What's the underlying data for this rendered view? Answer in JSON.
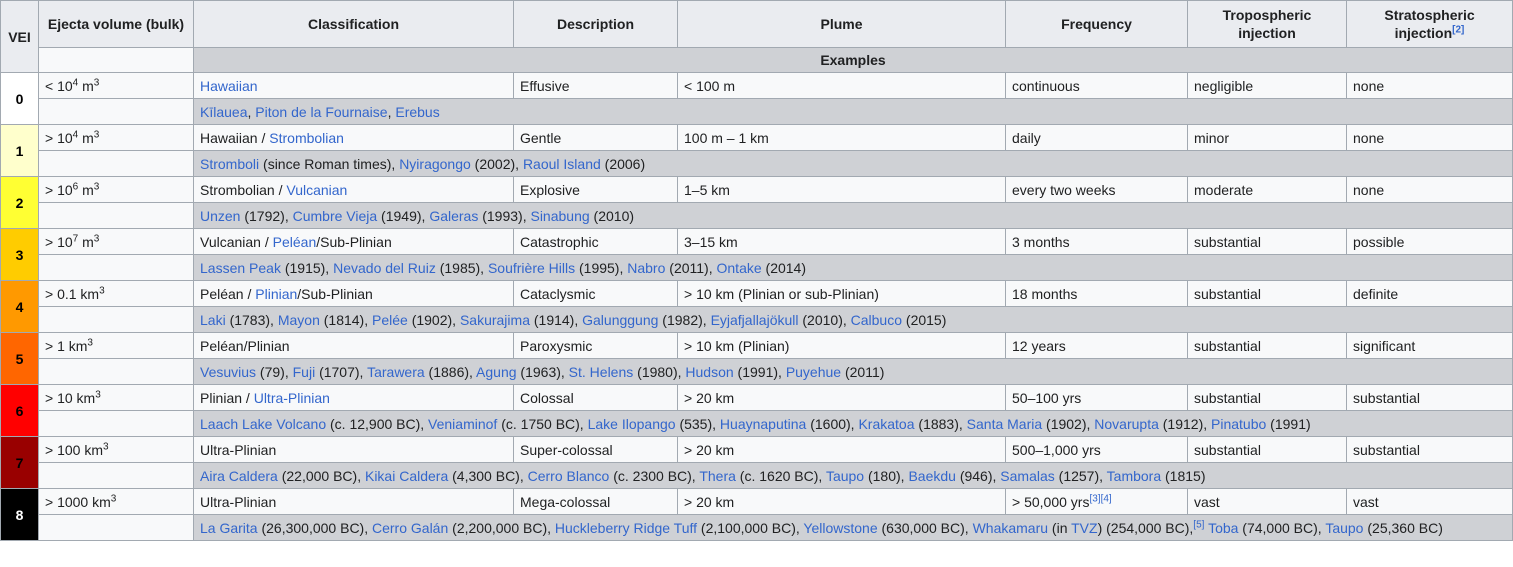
{
  "headers": {
    "vei": "VEI",
    "ejecta": "Ejecta volume (bulk)",
    "classification": "Classification",
    "description": "Description",
    "plume": "Plume",
    "frequency": "Frequency",
    "tropo_1": "Tropospheric",
    "tropo_2": "injection",
    "strato_1": "Stratospheric",
    "strato_2": "injection",
    "strato_ref": "[2]",
    "examples": "Examples"
  },
  "colors": {
    "vei0": "#ffffff",
    "vei1": "#ffffcc",
    "vei2": "#ffff33",
    "vei3": "#ffcc00",
    "vei4": "#ff9900",
    "vei5": "#ff6600",
    "vei6": "#ff0000",
    "vei7": "#990000",
    "vei8": "#000000",
    "link": "#3366cc",
    "header_bg": "#eaecf0",
    "examples_bg": "#cfd1d5",
    "border": "#a2a9b1"
  },
  "rows": [
    {
      "vei": "0",
      "vei_color": "#ffffff",
      "vei_text_color": "#000000",
      "ejecta": [
        {
          "t": "< 10"
        },
        {
          "sup": "4"
        },
        {
          "t": " m"
        },
        {
          "sup": "3"
        }
      ],
      "classification": [
        {
          "l": "Hawaiian"
        }
      ],
      "description": "Effusive",
      "plume": "< 100 m",
      "frequency": [
        {
          "t": "continuous"
        }
      ],
      "tropo": "negligible",
      "strato": "none",
      "examples": [
        {
          "l": "Kīlauea"
        },
        {
          "t": ", "
        },
        {
          "l": "Piton de la Fournaise"
        },
        {
          "t": ", "
        },
        {
          "l": "Erebus"
        }
      ]
    },
    {
      "vei": "1",
      "vei_color": "#ffffcc",
      "vei_text_color": "#000000",
      "ejecta": [
        {
          "t": "> 10"
        },
        {
          "sup": "4"
        },
        {
          "t": " m"
        },
        {
          "sup": "3"
        }
      ],
      "classification": [
        {
          "t": "Hawaiian / "
        },
        {
          "l": "Strombolian"
        }
      ],
      "description": "Gentle",
      "plume": "100 m – 1 km",
      "frequency": [
        {
          "t": "daily"
        }
      ],
      "tropo": "minor",
      "strato": "none",
      "examples": [
        {
          "l": "Stromboli"
        },
        {
          "t": " (since Roman times), "
        },
        {
          "l": "Nyiragongo"
        },
        {
          "t": " (2002), "
        },
        {
          "l": "Raoul Island"
        },
        {
          "t": " (2006)"
        }
      ]
    },
    {
      "vei": "2",
      "vei_color": "#ffff33",
      "vei_text_color": "#000000",
      "ejecta": [
        {
          "t": "> 10"
        },
        {
          "sup": "6"
        },
        {
          "t": " m"
        },
        {
          "sup": "3"
        }
      ],
      "classification": [
        {
          "t": "Strombolian / "
        },
        {
          "l": "Vulcanian"
        }
      ],
      "description": "Explosive",
      "plume": "1–5 km",
      "frequency": [
        {
          "t": "every two weeks"
        }
      ],
      "tropo": "moderate",
      "strato": "none",
      "examples": [
        {
          "l": "Unzen"
        },
        {
          "t": " (1792), "
        },
        {
          "l": "Cumbre Vieja"
        },
        {
          "t": " (1949), "
        },
        {
          "l": "Galeras"
        },
        {
          "t": " (1993), "
        },
        {
          "l": "Sinabung"
        },
        {
          "t": " (2010)"
        }
      ]
    },
    {
      "vei": "3",
      "vei_color": "#ffcc00",
      "vei_text_color": "#000000",
      "ejecta": [
        {
          "t": "> 10"
        },
        {
          "sup": "7"
        },
        {
          "t": " m"
        },
        {
          "sup": "3"
        }
      ],
      "classification": [
        {
          "t": "Vulcanian / "
        },
        {
          "l": "Peléan"
        },
        {
          "t": "/Sub-Plinian"
        }
      ],
      "description": "Catastrophic",
      "plume": "3–15 km",
      "frequency": [
        {
          "t": "3 months"
        }
      ],
      "tropo": "substantial",
      "strato": "possible",
      "examples": [
        {
          "l": "Lassen Peak"
        },
        {
          "t": " (1915), "
        },
        {
          "l": "Nevado del Ruiz"
        },
        {
          "t": " (1985), "
        },
        {
          "l": "Soufrière Hills"
        },
        {
          "t": " (1995), "
        },
        {
          "l": "Nabro"
        },
        {
          "t": " (2011), "
        },
        {
          "l": "Ontake"
        },
        {
          "t": " (2014)"
        }
      ]
    },
    {
      "vei": "4",
      "vei_color": "#ff9900",
      "vei_text_color": "#000000",
      "ejecta": [
        {
          "t": "> 0.1 km"
        },
        {
          "sup": "3"
        }
      ],
      "classification": [
        {
          "t": "Peléan / "
        },
        {
          "l": "Plinian"
        },
        {
          "t": "/Sub-Plinian"
        }
      ],
      "description": "Cataclysmic",
      "plume": "> 10 km (Plinian or sub-Plinian)",
      "frequency": [
        {
          "t": "18 months"
        }
      ],
      "tropo": "substantial",
      "strato": "definite",
      "examples": [
        {
          "l": "Laki"
        },
        {
          "t": " (1783), "
        },
        {
          "l": "Mayon"
        },
        {
          "t": " (1814), "
        },
        {
          "l": "Pelée"
        },
        {
          "t": " (1902), "
        },
        {
          "l": "Sakurajima"
        },
        {
          "t": " (1914), "
        },
        {
          "l": "Galunggung"
        },
        {
          "t": " (1982), "
        },
        {
          "l": "Eyjafjallajökull"
        },
        {
          "t": " (2010), "
        },
        {
          "l": "Calbuco"
        },
        {
          "t": " (2015)"
        }
      ]
    },
    {
      "vei": "5",
      "vei_color": "#ff6600",
      "vei_text_color": "#000000",
      "ejecta": [
        {
          "t": "> 1 km"
        },
        {
          "sup": "3"
        }
      ],
      "classification": [
        {
          "t": "Peléan/Plinian"
        }
      ],
      "description": "Paroxysmic",
      "plume": "> 10 km (Plinian)",
      "frequency": [
        {
          "t": "12 years"
        }
      ],
      "tropo": "substantial",
      "strato": "significant",
      "examples": [
        {
          "l": "Vesuvius"
        },
        {
          "t": " (79), "
        },
        {
          "l": "Fuji"
        },
        {
          "t": " (1707), "
        },
        {
          "l": "Tarawera"
        },
        {
          "t": " (1886), "
        },
        {
          "l": "Agung"
        },
        {
          "t": " (1963), "
        },
        {
          "l": "St. Helens"
        },
        {
          "t": " (1980), "
        },
        {
          "l": "Hudson"
        },
        {
          "t": " (1991), "
        },
        {
          "l": "Puyehue"
        },
        {
          "t": " (2011)"
        }
      ]
    },
    {
      "vei": "6",
      "vei_color": "#ff0000",
      "vei_text_color": "#000000",
      "ejecta": [
        {
          "t": "> 10 km"
        },
        {
          "sup": "3"
        }
      ],
      "classification": [
        {
          "t": "Plinian / "
        },
        {
          "l": "Ultra-Plinian"
        }
      ],
      "description": "Colossal",
      "plume": "> 20 km",
      "frequency": [
        {
          "t": "50–100 yrs"
        }
      ],
      "tropo": "substantial",
      "strato": "substantial",
      "examples": [
        {
          "l": "Laach Lake Volcano"
        },
        {
          "t": " (c. 12,900 BC), "
        },
        {
          "l": "Veniaminof"
        },
        {
          "t": " (c. 1750 BC), "
        },
        {
          "l": "Lake Ilopango"
        },
        {
          "t": " (535), "
        },
        {
          "l": "Huaynaputina"
        },
        {
          "t": " (1600), "
        },
        {
          "l": "Krakatoa"
        },
        {
          "t": " (1883), "
        },
        {
          "l": "Santa Maria"
        },
        {
          "t": " (1902), "
        },
        {
          "l": "Novarupta"
        },
        {
          "t": " (1912), "
        },
        {
          "l": "Pinatubo"
        },
        {
          "t": " (1991)"
        }
      ]
    },
    {
      "vei": "7",
      "vei_color": "#990000",
      "vei_text_color": "#000000",
      "ejecta": [
        {
          "t": "> 100 km"
        },
        {
          "sup": "3"
        }
      ],
      "classification": [
        {
          "t": "Ultra-Plinian"
        }
      ],
      "description": "Super-colossal",
      "plume": "> 20 km",
      "frequency": [
        {
          "t": "500–1,000 yrs"
        }
      ],
      "tropo": "substantial",
      "strato": "substantial",
      "examples": [
        {
          "l": "Aira Caldera"
        },
        {
          "t": " (22,000 BC), "
        },
        {
          "l": "Kikai Caldera"
        },
        {
          "t": " (4,300 BC), "
        },
        {
          "l": "Cerro Blanco"
        },
        {
          "t": " (c. 2300 BC), "
        },
        {
          "l": "Thera"
        },
        {
          "t": " (c. 1620 BC), "
        },
        {
          "l": "Taupo"
        },
        {
          "t": " (180), "
        },
        {
          "l": "Baekdu"
        },
        {
          "t": " (946), "
        },
        {
          "l": "Samalas"
        },
        {
          "t": " (1257), "
        },
        {
          "l": "Tambora"
        },
        {
          "t": " (1815)"
        }
      ]
    },
    {
      "vei": "8",
      "vei_color": "#000000",
      "vei_text_color": "#ffffff",
      "ejecta": [
        {
          "t": "> 1000 km"
        },
        {
          "sup": "3"
        }
      ],
      "classification": [
        {
          "t": "Ultra-Plinian"
        }
      ],
      "description": "Mega-colossal",
      "plume": "> 20 km",
      "frequency": [
        {
          "t": "> 50,000 yrs"
        },
        {
          "supl": "[3]"
        },
        {
          "supl": "[4]"
        }
      ],
      "tropo": "vast",
      "strato": "vast",
      "examples": [
        {
          "l": "La Garita"
        },
        {
          "t": " (26,300,000 BC), "
        },
        {
          "l": "Cerro Galán"
        },
        {
          "t": " (2,200,000 BC), "
        },
        {
          "l": "Huckleberry Ridge Tuff"
        },
        {
          "t": " (2,100,000 BC), "
        },
        {
          "l": "Yellowstone"
        },
        {
          "t": " (630,000 BC), "
        },
        {
          "l": "Whakamaru"
        },
        {
          "t": " (in "
        },
        {
          "l": "TVZ"
        },
        {
          "t": ") (254,000 BC),"
        },
        {
          "supl": "[5]"
        },
        {
          "t": " "
        },
        {
          "l": "Toba"
        },
        {
          "t": " (74,000 BC), "
        },
        {
          "l": "Taupo"
        },
        {
          "t": " (25,360 BC)"
        }
      ]
    }
  ]
}
